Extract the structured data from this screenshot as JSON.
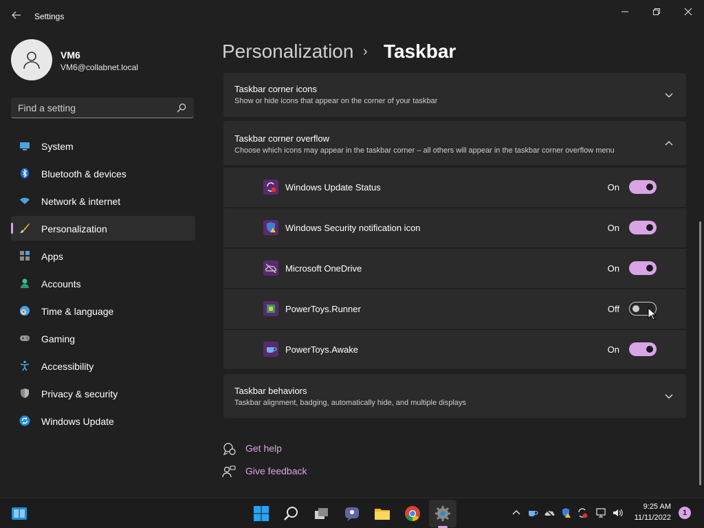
{
  "window": {
    "title": "Settings"
  },
  "user": {
    "name": "VM6",
    "email": "VM6@collabnet.local"
  },
  "search": {
    "placeholder": "Find a setting"
  },
  "nav": {
    "items": [
      {
        "label": "System",
        "icon": "monitor-icon"
      },
      {
        "label": "Bluetooth & devices",
        "icon": "bluetooth-icon"
      },
      {
        "label": "Network & internet",
        "icon": "wifi-icon"
      },
      {
        "label": "Personalization",
        "icon": "brush-icon",
        "selected": true
      },
      {
        "label": "Apps",
        "icon": "apps-icon"
      },
      {
        "label": "Accounts",
        "icon": "person-icon"
      },
      {
        "label": "Time & language",
        "icon": "clock-globe-icon"
      },
      {
        "label": "Gaming",
        "icon": "gamepad-icon"
      },
      {
        "label": "Accessibility",
        "icon": "accessibility-icon"
      },
      {
        "label": "Privacy & security",
        "icon": "shield-icon"
      },
      {
        "label": "Windows Update",
        "icon": "sync-icon"
      }
    ]
  },
  "breadcrumb": {
    "parent": "Personalization",
    "separator": "›",
    "current": "Taskbar"
  },
  "sections": {
    "corner_icons": {
      "title": "Taskbar corner icons",
      "description": "Show or hide icons that appear on the corner of your taskbar",
      "expanded": false
    },
    "corner_overflow": {
      "title": "Taskbar corner overflow",
      "description": "Choose which icons may appear in the taskbar corner – all others will appear in the taskbar corner overflow menu",
      "expanded": true,
      "items": [
        {
          "label": "Windows Update Status",
          "state": "On",
          "on": true
        },
        {
          "label": "Windows Security notification icon",
          "state": "On",
          "on": true
        },
        {
          "label": "Microsoft OneDrive",
          "state": "On",
          "on": true
        },
        {
          "label": "PowerToys.Runner",
          "state": "Off",
          "on": false
        },
        {
          "label": "PowerToys.Awake",
          "state": "On",
          "on": true
        }
      ]
    },
    "behaviors": {
      "title": "Taskbar behaviors",
      "description": "Taskbar alignment, badging, automatically hide, and multiple displays",
      "expanded": false
    }
  },
  "links": {
    "help": "Get help",
    "feedback": "Give feedback"
  },
  "taskbar": {
    "clock": {
      "time": "9:25 AM",
      "date": "11/11/2022"
    },
    "notifications": "1"
  },
  "colors": {
    "accent": "#d9a4e6",
    "background": "#202020",
    "card": "#2b2b2b"
  }
}
